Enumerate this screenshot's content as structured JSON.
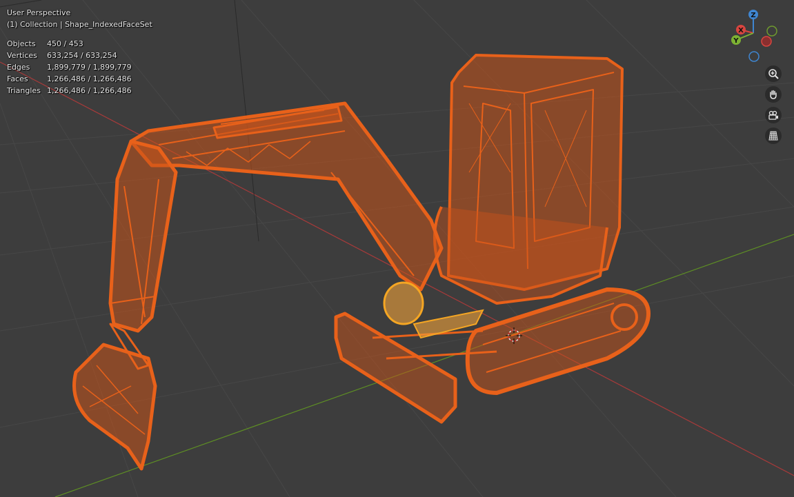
{
  "viewport": {
    "view_name": "User Perspective",
    "collection_line": "(1) Collection | Shape_IndexedFaceSet"
  },
  "stats": [
    {
      "label": "Objects",
      "value": "450 / 453"
    },
    {
      "label": "Vertices",
      "value": "633,254 / 633,254"
    },
    {
      "label": "Edges",
      "value": "1,899,779 / 1,899,779"
    },
    {
      "label": "Faces",
      "value": "1,266,486 / 1,266,486"
    },
    {
      "label": "Triangles",
      "value": "1,266,486 / 1,266,486"
    }
  ],
  "gizmo": {
    "x_label": "X",
    "y_label": "Y",
    "z_label": "Z",
    "x_color": "#d9453f",
    "y_color": "#7db233",
    "z_color": "#3f86d1"
  },
  "navigation_tools": [
    {
      "name": "zoom",
      "icon": "zoom-icon"
    },
    {
      "name": "pan",
      "icon": "hand-icon"
    },
    {
      "name": "camera",
      "icon": "camera-icon"
    },
    {
      "name": "ortho-toggle",
      "icon": "grid-icon"
    }
  ],
  "colors": {
    "background": "#3d3d3d",
    "selection_wire": "#e8611a",
    "active_wire": "#f5a623",
    "x_axis_line": "#b33a3a",
    "y_axis_line": "#5e8f24"
  }
}
